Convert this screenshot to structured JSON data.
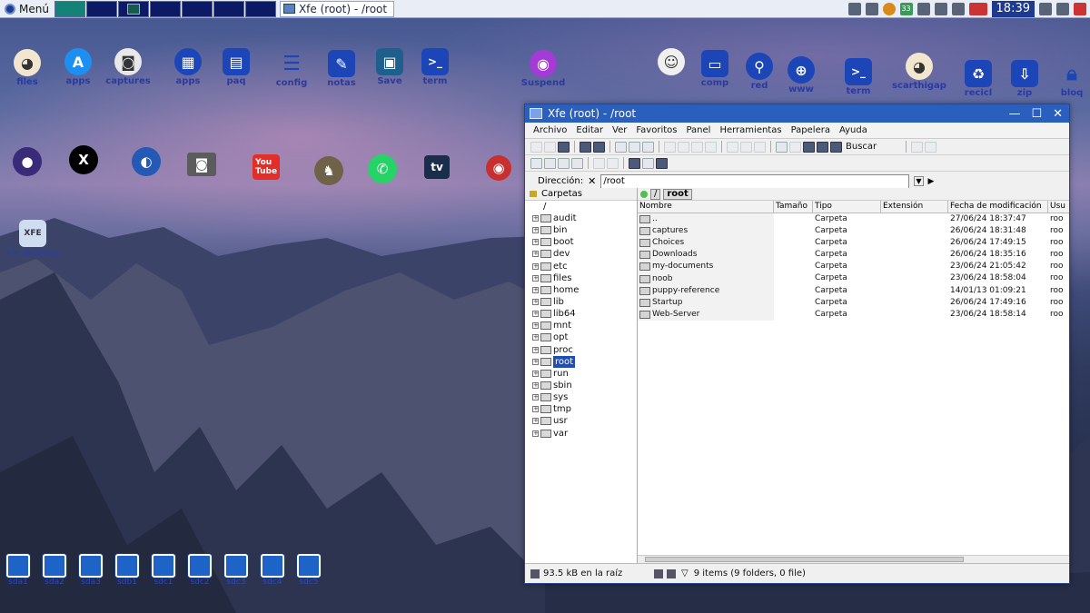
{
  "taskbar": {
    "menu_label": "Menú",
    "active_task": "Xfe (root) - /root",
    "clock": "18:39",
    "tray_number": "33"
  },
  "desktop_icons": {
    "row1": [
      {
        "label": "files",
        "icon": "puppy-icon"
      },
      {
        "label": "apps",
        "icon": "appstore-icon"
      },
      {
        "label": "captures",
        "icon": "camera-icon"
      },
      {
        "label": "apps",
        "icon": "grid-icon"
      },
      {
        "label": "paq",
        "icon": "package-icon"
      },
      {
        "label": "config",
        "icon": "sliders-icon"
      },
      {
        "label": "notas",
        "icon": "notes-icon"
      },
      {
        "label": "Save",
        "icon": "save-icon"
      },
      {
        "label": "term",
        "icon": "terminal-icon"
      },
      {
        "label": "Suspend",
        "icon": "suspend-icon"
      }
    ],
    "row1_right": [
      {
        "label": "comp",
        "icon": "monitors-icon"
      },
      {
        "label": "red",
        "icon": "network-icon"
      },
      {
        "label": "www",
        "icon": "globe-icon"
      },
      {
        "label": "term",
        "icon": "terminal-icon"
      },
      {
        "label": "scarthigap",
        "icon": "puppy-icon"
      },
      {
        "label": "recicl",
        "icon": "recycle-icon"
      },
      {
        "label": "zip",
        "icon": "zip-icon"
      },
      {
        "label": "bloq",
        "icon": "lock-icon"
      }
    ],
    "xfe_desktop": "xfe desktop",
    "drives": [
      "sda1",
      "sda2",
      "sda3",
      "sdb1",
      "sdc1",
      "sdc2",
      "sdc3",
      "sdc4",
      "sdc5"
    ]
  },
  "window": {
    "title": "Xfe (root) - /root",
    "menus": [
      "Archivo",
      "Editar",
      "Ver",
      "Favoritos",
      "Panel",
      "Herramientas",
      "Papelera",
      "Ayuda"
    ],
    "search_label": "Buscar",
    "address_label": "Dirección:",
    "address_value": "/root",
    "tree_header": "Carpetas",
    "tree_root": "/",
    "tree": [
      "audit",
      "bin",
      "boot",
      "dev",
      "etc",
      "files",
      "home",
      "lib",
      "lib64",
      "mnt",
      "opt",
      "proc",
      "root",
      "run",
      "sbin",
      "sys",
      "tmp",
      "usr",
      "var"
    ],
    "selected_tree_item": "root",
    "crumbs": [
      "/",
      "root"
    ],
    "columns": [
      "Nombre",
      "Tamaño",
      "Tipo",
      "Extensión",
      "Fecha de modificación",
      "Usu"
    ],
    "rows": [
      {
        "name": "..",
        "type": "Carpeta",
        "date": "27/06/24 18:37:47",
        "user": "roo"
      },
      {
        "name": "captures",
        "type": "Carpeta",
        "date": "26/06/24 18:31:48",
        "user": "roo"
      },
      {
        "name": "Choices",
        "type": "Carpeta",
        "date": "26/06/24 17:49:15",
        "user": "roo"
      },
      {
        "name": "Downloads",
        "type": "Carpeta",
        "date": "26/06/24 18:35:16",
        "user": "roo"
      },
      {
        "name": "my-documents",
        "type": "Carpeta",
        "date": "23/06/24 21:05:42",
        "user": "roo"
      },
      {
        "name": "noob",
        "type": "Carpeta",
        "date": "23/06/24 18:58:04",
        "user": "roo"
      },
      {
        "name": "puppy-reference",
        "type": "Carpeta",
        "date": "14/01/13 01:09:21",
        "user": "roo"
      },
      {
        "name": "Startup",
        "type": "Carpeta",
        "date": "26/06/24 17:49:16",
        "user": "roo"
      },
      {
        "name": "Web-Server",
        "type": "Carpeta",
        "date": "23/06/24 18:58:14",
        "user": "roo"
      }
    ],
    "status_left": "93.5 kB en la raíz",
    "status_right": "9 items (9 folders, 0 file)"
  },
  "colors": {
    "title_bar": "#2a5fbd",
    "taskbar": "#e9eef6",
    "clock_bg": "#1e3a8f",
    "selection": "#1e4fb7"
  }
}
